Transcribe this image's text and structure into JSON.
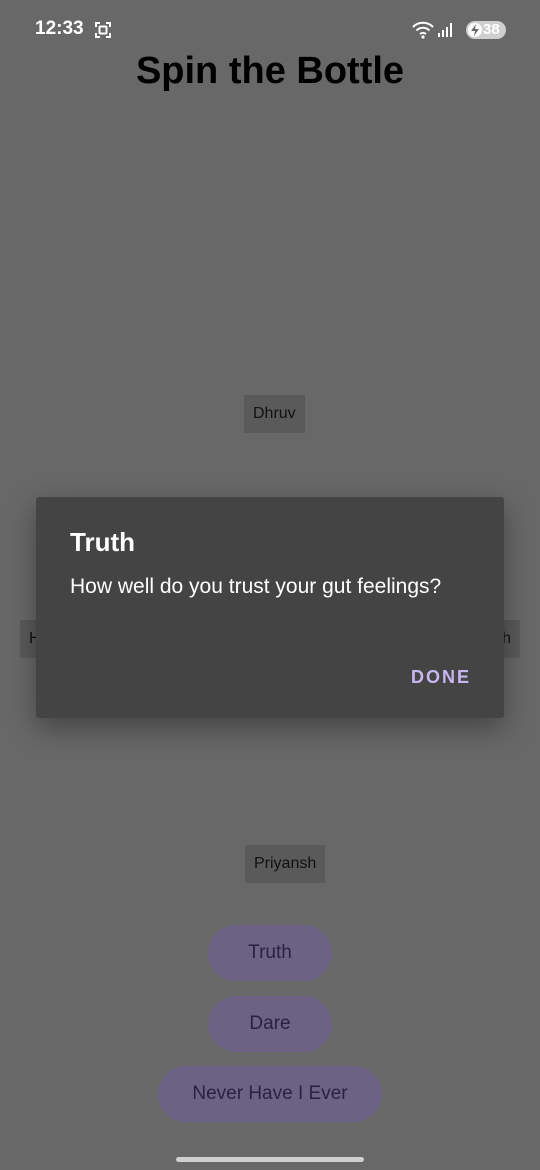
{
  "status_bar": {
    "time": "12:33",
    "battery_level": "38",
    "icons": [
      "screen-record-icon",
      "wifi-icon",
      "signal-icon",
      "battery-icon"
    ]
  },
  "page": {
    "title": "Spin the Bottle"
  },
  "players": {
    "top": "Dhruv",
    "bottom": "Priyansh",
    "left_visible": "H",
    "right_visible": "h"
  },
  "actions": {
    "truth_label": "Truth",
    "dare_label": "Dare",
    "never_label": "Never Have I Ever"
  },
  "dialog": {
    "title": "Truth",
    "message": "How well do you trust your gut feelings?",
    "done_label": "DONE"
  },
  "colors": {
    "scrim_background": "#686868",
    "dialog_background": "#444444",
    "accent_text": "#c8b6f0",
    "button_fill": "#6b6284"
  }
}
